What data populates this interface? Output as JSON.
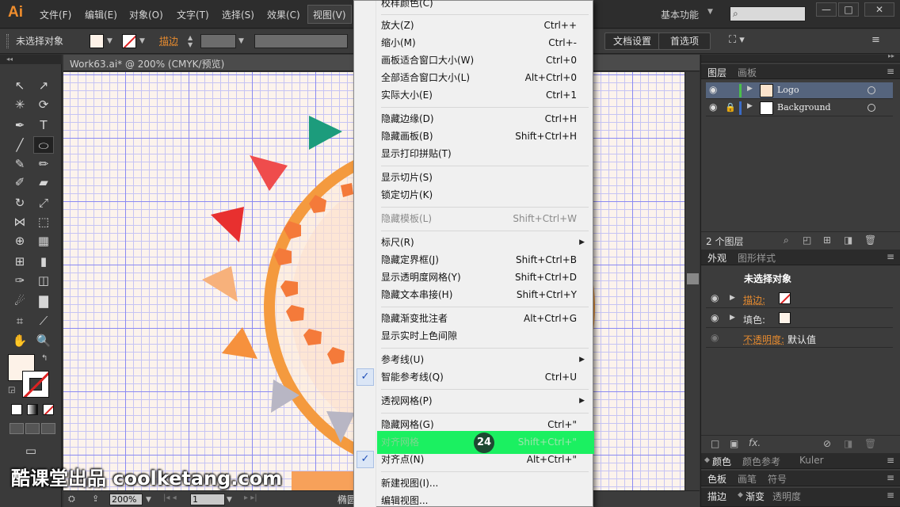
{
  "app": {
    "logo": "Ai",
    "menus": [
      "文件(F)",
      "编辑(E)",
      "对象(O)",
      "文字(T)",
      "选择(S)",
      "效果(C)",
      "视图(V)"
    ],
    "workspace": "基本功能"
  },
  "window": {
    "min": "—",
    "max": "□",
    "close": "✕"
  },
  "control": {
    "no_selection": "未选择对象",
    "stroke_label": "描边",
    "doc_setup": "文档设置",
    "preferences": "首选项"
  },
  "document": {
    "tab_title": "Work63.ai* @ 200% (CMYK/预览)",
    "zoom": "200%",
    "artboard": "1",
    "status_text": "椭圆"
  },
  "watermark": "酷课堂出品 coolketang.com",
  "menu": {
    "top_partial": "校样颜色(C)",
    "items": [
      {
        "label": "放大(Z)",
        "shortcut": "Ctrl++"
      },
      {
        "label": "缩小(M)",
        "shortcut": "Ctrl+-"
      },
      {
        "label": "画板适合窗口大小(W)",
        "shortcut": "Ctrl+0"
      },
      {
        "label": "全部适合窗口大小(L)",
        "shortcut": "Alt+Ctrl+0"
      },
      {
        "label": "实际大小(E)",
        "shortcut": "Ctrl+1"
      },
      {
        "label": "隐藏边缘(D)",
        "shortcut": "Ctrl+H"
      },
      {
        "label": "隐藏画板(B)",
        "shortcut": "Shift+Ctrl+H"
      },
      {
        "label": "显示打印拼贴(T)",
        "shortcut": ""
      },
      {
        "label": "显示切片(S)",
        "shortcut": ""
      },
      {
        "label": "锁定切片(K)",
        "shortcut": ""
      },
      {
        "label": "隐藏模板(L)",
        "shortcut": "Shift+Ctrl+W"
      },
      {
        "label": "标尺(R)",
        "shortcut": ""
      },
      {
        "label": "隐藏定界框(J)",
        "shortcut": "Shift+Ctrl+B"
      },
      {
        "label": "显示透明度网格(Y)",
        "shortcut": "Shift+Ctrl+D"
      },
      {
        "label": "隐藏文本串接(H)",
        "shortcut": "Shift+Ctrl+Y"
      },
      {
        "label": "隐藏渐变批注者",
        "shortcut": "Alt+Ctrl+G"
      },
      {
        "label": "显示实时上色间隙",
        "shortcut": ""
      },
      {
        "label": "参考线(U)",
        "shortcut": ""
      },
      {
        "label": "智能参考线(Q)",
        "shortcut": "Ctrl+U"
      },
      {
        "label": "透视网格(P)",
        "shortcut": ""
      },
      {
        "label": "隐藏网格(G)",
        "shortcut": "Ctrl+\""
      },
      {
        "label": "对齐网格",
        "shortcut": "Shift+Ctrl+\""
      },
      {
        "label": "对齐点(N)",
        "shortcut": "Alt+Ctrl+\""
      },
      {
        "label": "新建视图(I)...",
        "shortcut": ""
      },
      {
        "label": "编辑视图...",
        "shortcut": ""
      }
    ],
    "step_badge": "24"
  },
  "layers_panel": {
    "tabs": [
      "图层",
      "画板"
    ],
    "layers": [
      {
        "name": "Logo",
        "color": "#3c8f3c"
      },
      {
        "name": "Background",
        "color": "#3b6bc7"
      }
    ],
    "count": "2 个图层"
  },
  "appearance_panel": {
    "tabs": [
      "外观",
      "图形样式"
    ],
    "title": "未选择对象",
    "rows": [
      "描边:",
      "填色:",
      "不透明度:"
    ],
    "opacity_value": "默认值"
  },
  "bottom_panels": {
    "row1": [
      "颜色",
      "颜色参考",
      "Kuler"
    ],
    "row2": [
      "色板",
      "画笔",
      "符号"
    ],
    "row3": [
      "描边",
      "渐变",
      "透明度"
    ]
  }
}
